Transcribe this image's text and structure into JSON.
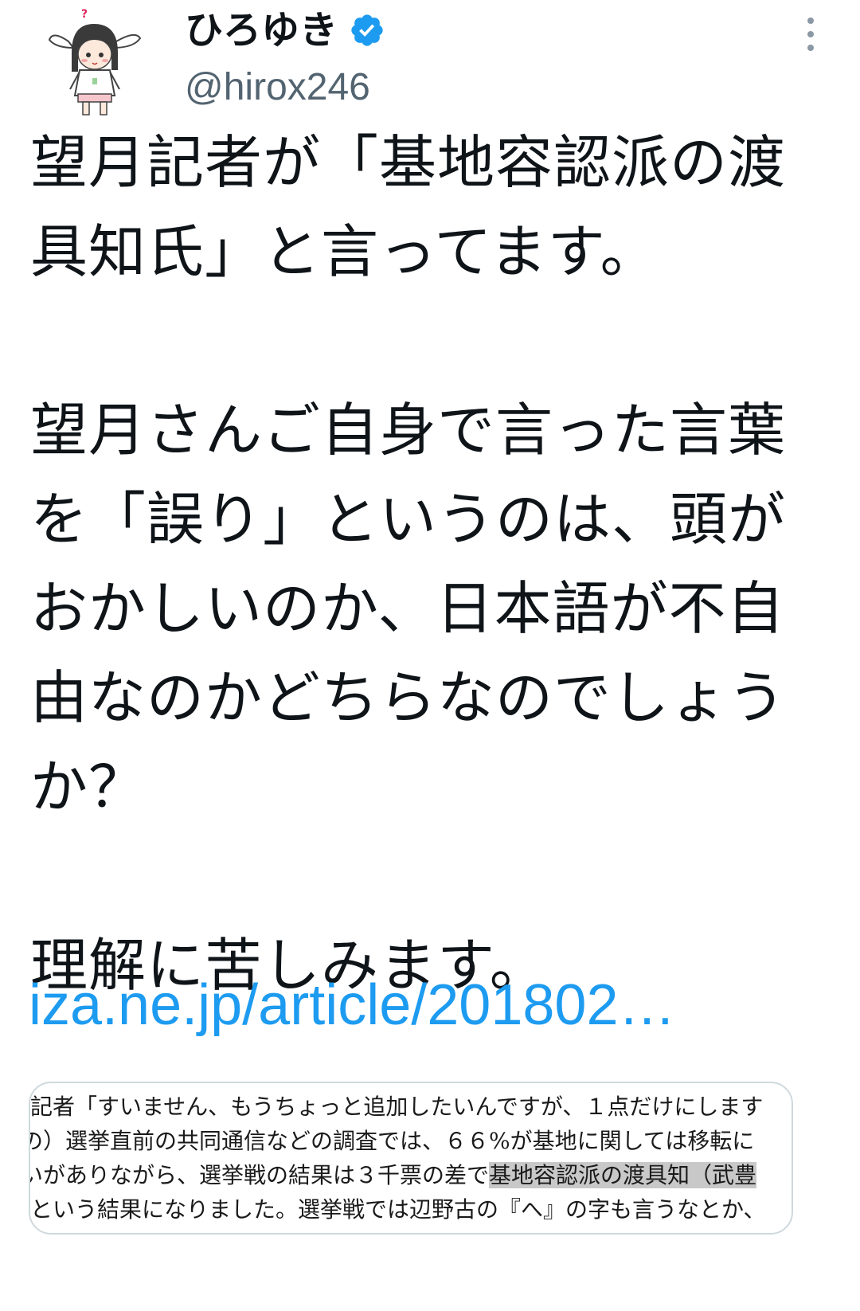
{
  "author": {
    "display_name": "ひろゆき",
    "handle": "@hirox246",
    "verified": true,
    "avatar_icon": "bunny-ear-girl-avatar",
    "verified_icon": "verified-badge-icon",
    "more_icon": "more-vertical-icon"
  },
  "tweet": {
    "text": "望月記者が「基地容認派の渡\n具知氏」と言ってます。\n\n望月さんご自身で言った言葉\nを「誤り」というのは、頭が\nおかしいのか、日本語が不自\n由なのかどちらなのでしょう\nか？\n\n理解に苦しみます。",
    "link": "iza.ne.jp/article/201802…"
  },
  "media": {
    "line1": "記者「すいません、もうちょっと追加したいんですが、１点だけにします",
    "line2": "の）選挙直前の共同通信などの調査では、６６%が基地に関しては移転に",
    "line3_before": "いがありながら、選挙戦の結果は３千票の差で",
    "line3_highlight": "基地容認派の渡具知（武豊",
    "line4": "という結果になりました。選挙戦では辺野古の『へ』の字も言うなとか、"
  },
  "colors": {
    "link": "#1d9bf0",
    "handle": "#536471",
    "verified": "#1d9bf0",
    "highlight": "#c8c8c8"
  }
}
